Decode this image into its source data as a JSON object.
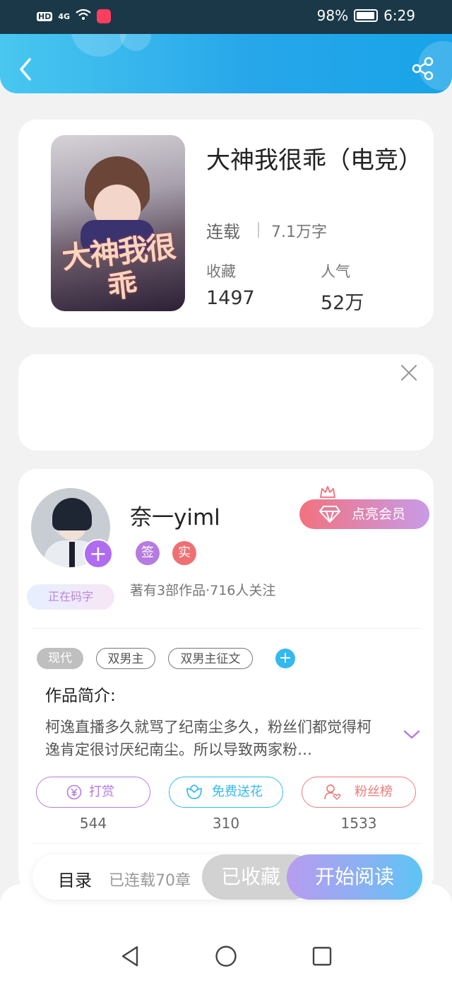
{
  "status_bar": {
    "signal_text": "4G",
    "battery_percent": "98%",
    "time": "6:29"
  },
  "book": {
    "title": "大神我很乖（电竞）",
    "cover_title": "大神我很乖",
    "status": "连载",
    "word_count": "7.1万字",
    "favorites_label": "收藏",
    "favorites_value": "1497",
    "popularity_label": "人气",
    "popularity_value": "52万"
  },
  "author": {
    "name": "奈一yiml",
    "badge_signed": "签",
    "badge_verified": "实",
    "writing_status": "正在码字",
    "meta": "著有3部作品·716人关注",
    "vip_button_label": "点亮会员"
  },
  "tags": [
    "现代",
    "双男主",
    "双男主征文"
  ],
  "intro": {
    "title": "作品简介:",
    "text": "柯逸直播多久就骂了纪南尘多久，粉丝们都觉得柯逸肯定很讨厌纪南尘。所以导致两家粉…"
  },
  "actions": [
    {
      "label": "打赏",
      "count": "544",
      "color": "#b57be0"
    },
    {
      "label": "免费送花",
      "count": "310",
      "color": "#35b8ef"
    },
    {
      "label": "粉丝榜",
      "count": "1533",
      "color": "#ee7b7b"
    }
  ],
  "bottom_bar": {
    "toc_label": "目录",
    "chapter_status": "已连载70章",
    "collected_label": "已收藏",
    "read_label": "开始阅读"
  },
  "colors": {
    "header_start": "#49c7f0",
    "header_end": "#19a3e8",
    "badge_signed": "#b57be0",
    "badge_verified": "#ef6f73"
  }
}
